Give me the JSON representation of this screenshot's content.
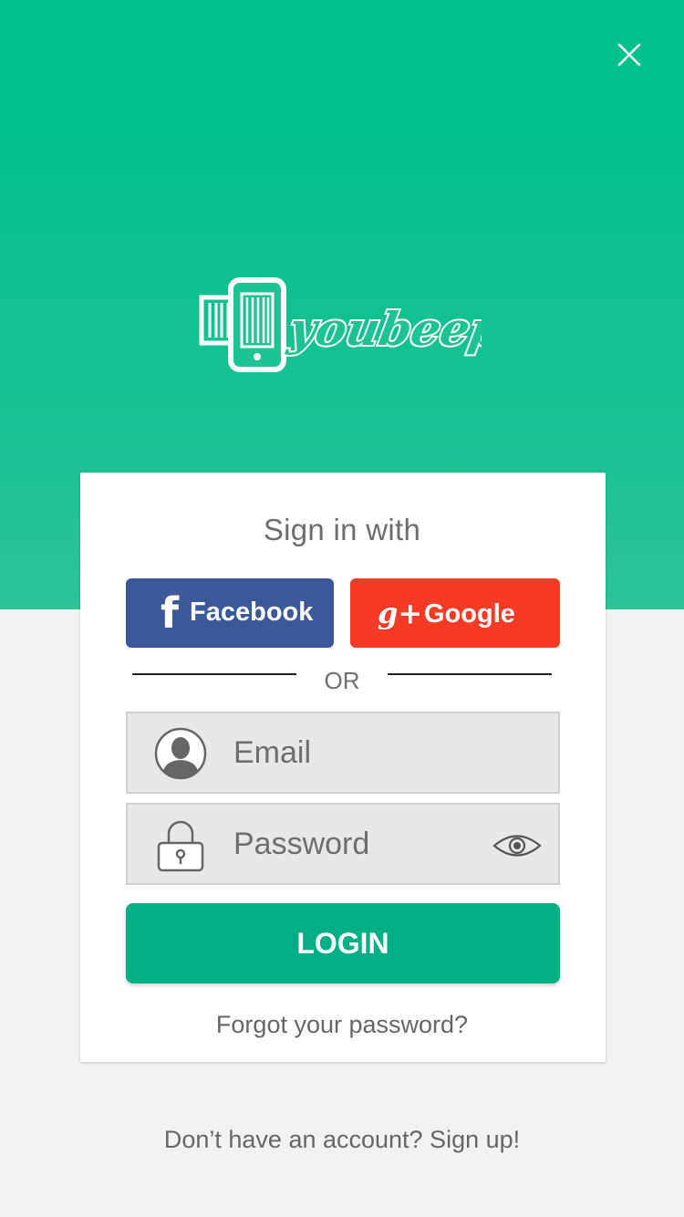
{
  "brand": {
    "name": "youbeep",
    "color": "#00c08c"
  },
  "signin": {
    "title": "Sign in with"
  },
  "social": {
    "facebook": {
      "label": "Facebook",
      "color": "#3b5999",
      "icon": "facebook-icon"
    },
    "google": {
      "label": "Google",
      "color": "#f53a26",
      "icon": "google-plus-icon"
    }
  },
  "divider": {
    "label": "OR"
  },
  "form": {
    "email": {
      "placeholder": "Email",
      "value": "",
      "icon": "user-icon"
    },
    "password": {
      "placeholder": "Password",
      "value": "",
      "icon": "lock-icon",
      "toggle_icon": "eye-icon"
    },
    "login_label": "LOGIN",
    "forgot_label": "Forgot your password?"
  },
  "footer": {
    "signup_label": "Don’t have an account? Sign up!"
  },
  "colors": {
    "login": "#00af86",
    "background": "#f2f2f2"
  }
}
